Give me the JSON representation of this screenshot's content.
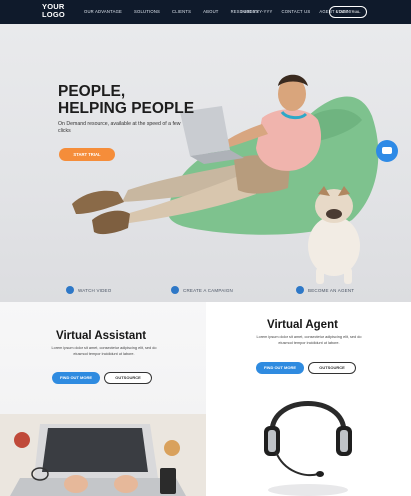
{
  "nav": {
    "logo_line1": "YOUR",
    "logo_line2": "LOGO",
    "menu_left": [
      "OUR ADVANTAGE",
      "SOLUTIONS",
      "CLIENTS",
      "ABOUT",
      "RESOURCES"
    ],
    "menu_right": [
      "1-800-YYY-YYY",
      "CONTACT US",
      "AGENT LOGIN"
    ],
    "cta_label": "START TRIAL"
  },
  "hero": {
    "title_line1": "PEOPLE,",
    "title_line2": "HELPING PEOPLE",
    "subtitle": "On Demand resource, available at the speed of a few clicks",
    "button_label": "START TRIAL"
  },
  "features": [
    {
      "icon": "play-icon",
      "label": "WATCH VIDEO"
    },
    {
      "icon": "gear-icon",
      "label": "CREATE A CAMPAIGN"
    },
    {
      "icon": "headset-icon",
      "label": "BECOME AN AGENT"
    }
  ],
  "virtual_assistant": {
    "title": "Virtual Assistant",
    "description": "Lorem ipsum dolor sit amet, consectetur adipiscing elit, sed do eiusmod tempor incididunt ut labore.",
    "primary_label": "FIND OUT MORE",
    "secondary_label": "OUTSOURCE"
  },
  "virtual_agent": {
    "title": "Virtual Agent",
    "description": "Lorem ipsum dolor sit amet, consectetur adipiscing elit, sed do eiusmod tempor incididunt ut labore.",
    "primary_label": "FIND OUT MORE",
    "secondary_label": "OUTSOURCE"
  },
  "colors": {
    "nav_bg": "#0f1a2b",
    "accent_orange": "#f58d3a",
    "accent_blue": "#2f8be0",
    "beanbag_green": "#7ec28e"
  }
}
